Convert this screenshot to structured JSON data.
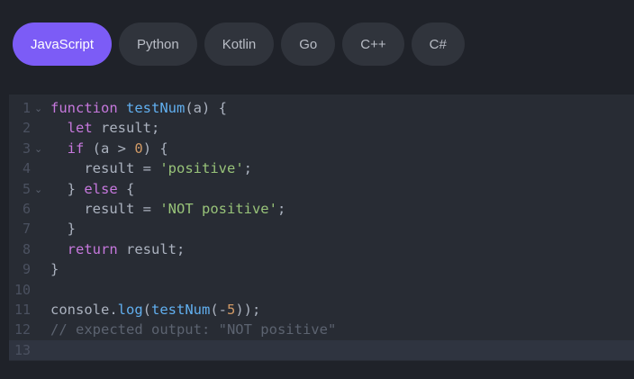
{
  "tabs": [
    {
      "label": "JavaScript",
      "active": true
    },
    {
      "label": "Python",
      "active": false
    },
    {
      "label": "Kotlin",
      "active": false
    },
    {
      "label": "Go",
      "active": false
    },
    {
      "label": "C++",
      "active": false
    },
    {
      "label": "C#",
      "active": false
    }
  ],
  "colors": {
    "active_tab": "#7c5cf6",
    "tab_bg": "#30343c",
    "page_bg": "#1f2229",
    "editor_bg": "#282c34",
    "keyword": "#c678dd",
    "function": "#61afef",
    "number": "#d19a66",
    "string": "#98c379",
    "comment": "#5c6370"
  },
  "editor": {
    "lines": [
      {
        "n": "1",
        "fold": true,
        "tokens": [
          {
            "t": "function",
            "c": "kw"
          },
          {
            "t": " ",
            "c": "plain"
          },
          {
            "t": "testNum",
            "c": "fn"
          },
          {
            "t": "(a) {",
            "c": "plain"
          }
        ]
      },
      {
        "n": "2",
        "fold": false,
        "tokens": [
          {
            "t": "  ",
            "c": "plain"
          },
          {
            "t": "let",
            "c": "kw"
          },
          {
            "t": " result;",
            "c": "plain"
          }
        ]
      },
      {
        "n": "3",
        "fold": true,
        "tokens": [
          {
            "t": "  ",
            "c": "plain"
          },
          {
            "t": "if",
            "c": "kw"
          },
          {
            "t": " (a > ",
            "c": "plain"
          },
          {
            "t": "0",
            "c": "num"
          },
          {
            "t": ") {",
            "c": "plain"
          }
        ]
      },
      {
        "n": "4",
        "fold": false,
        "tokens": [
          {
            "t": "    result = ",
            "c": "plain"
          },
          {
            "t": "'positive'",
            "c": "str"
          },
          {
            "t": ";",
            "c": "plain"
          }
        ]
      },
      {
        "n": "5",
        "fold": true,
        "tokens": [
          {
            "t": "  } ",
            "c": "plain"
          },
          {
            "t": "else",
            "c": "kw"
          },
          {
            "t": " {",
            "c": "plain"
          }
        ]
      },
      {
        "n": "6",
        "fold": false,
        "tokens": [
          {
            "t": "    result = ",
            "c": "plain"
          },
          {
            "t": "'NOT positive'",
            "c": "str"
          },
          {
            "t": ";",
            "c": "plain"
          }
        ]
      },
      {
        "n": "7",
        "fold": false,
        "tokens": [
          {
            "t": "  }",
            "c": "plain"
          }
        ]
      },
      {
        "n": "8",
        "fold": false,
        "tokens": [
          {
            "t": "  ",
            "c": "plain"
          },
          {
            "t": "return",
            "c": "kw"
          },
          {
            "t": " result;",
            "c": "plain"
          }
        ]
      },
      {
        "n": "9",
        "fold": false,
        "tokens": [
          {
            "t": "}",
            "c": "plain"
          }
        ]
      },
      {
        "n": "10",
        "fold": false,
        "tokens": []
      },
      {
        "n": "11",
        "fold": false,
        "tokens": [
          {
            "t": "console.",
            "c": "plain"
          },
          {
            "t": "log",
            "c": "fn"
          },
          {
            "t": "(",
            "c": "plain"
          },
          {
            "t": "testNum",
            "c": "fn"
          },
          {
            "t": "(-",
            "c": "plain"
          },
          {
            "t": "5",
            "c": "num"
          },
          {
            "t": "));",
            "c": "plain"
          }
        ]
      },
      {
        "n": "12",
        "fold": false,
        "tokens": [
          {
            "t": "// expected output: \"NOT positive\"",
            "c": "com"
          }
        ]
      },
      {
        "n": "13",
        "fold": false,
        "active": true,
        "tokens": []
      }
    ]
  }
}
